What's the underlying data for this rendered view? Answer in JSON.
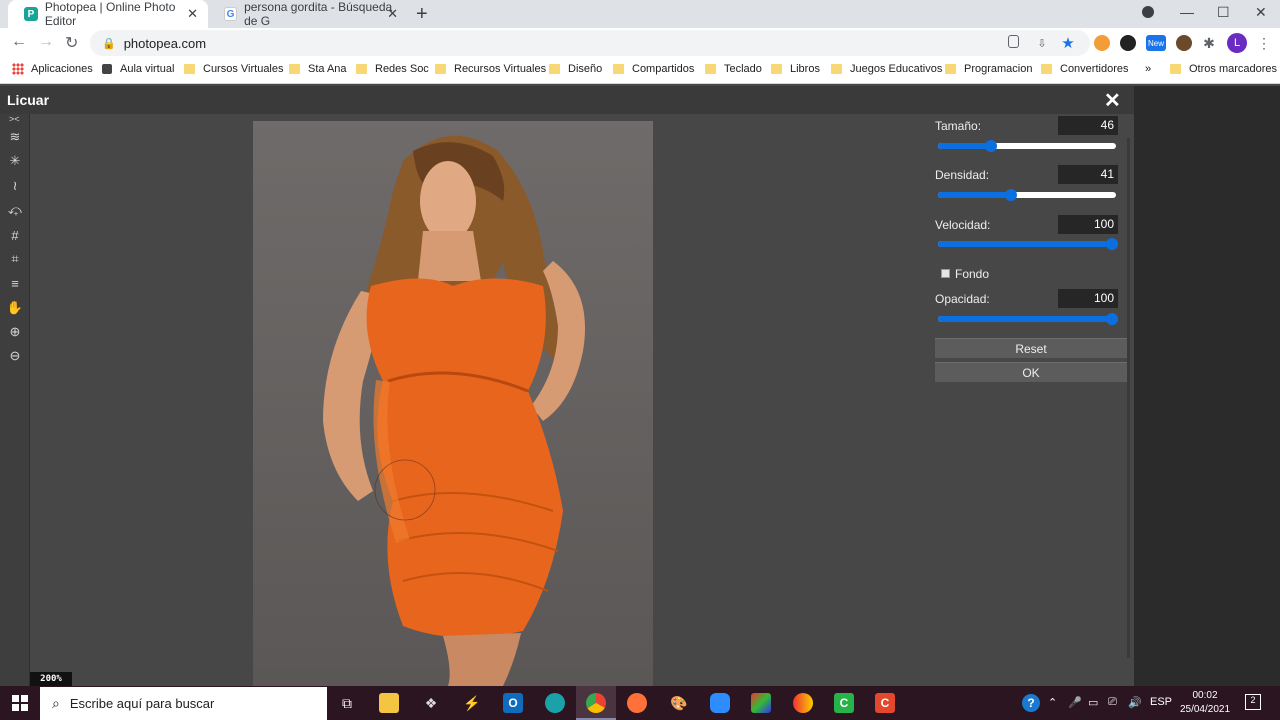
{
  "browser": {
    "tabs": [
      {
        "title": "Photopea | Online Photo Editor",
        "active": true
      },
      {
        "title": "persona gordita - Búsqueda de G",
        "active": false
      }
    ],
    "url": "photopea.com",
    "bookmarks": [
      "Aplicaciones",
      "Aula virtual",
      "Cursos Virtuales",
      "Sta Ana",
      "Redes Soc",
      "Recursos Virtuales",
      "Diseño",
      "Compartidos",
      "Teclado",
      "Libros",
      "Juegos Educativos",
      "Programacion",
      "Convertidores"
    ],
    "overflow_label": "»",
    "other_bookmarks": "Otros marcadores",
    "profile_initial": "L",
    "new_badge": "New"
  },
  "liquify": {
    "title": "Licuar",
    "zoom": "200%",
    "controls": {
      "size_label": "Tamaño:",
      "size_value": "46",
      "size_fraction": 0.3,
      "density_label": "Densidad:",
      "density_value": "41",
      "density_fraction": 0.41,
      "speed_label": "Velocidad:",
      "speed_value": "100",
      "speed_fraction": 1.0,
      "background_label": "Fondo",
      "opacity_label": "Opacidad:",
      "opacity_value": "100",
      "opacity_fraction": 1.0
    },
    "buttons": {
      "reset": "Reset",
      "ok": "OK"
    }
  },
  "taskbar": {
    "search_placeholder": "Escribe aquí para buscar",
    "language": "ESP",
    "time": "00:02",
    "date": "25/04/2021",
    "notifications": "2"
  },
  "colors": {
    "accent": "#0b6fe0",
    "dress": "#e8651e",
    "background": "#474747"
  }
}
